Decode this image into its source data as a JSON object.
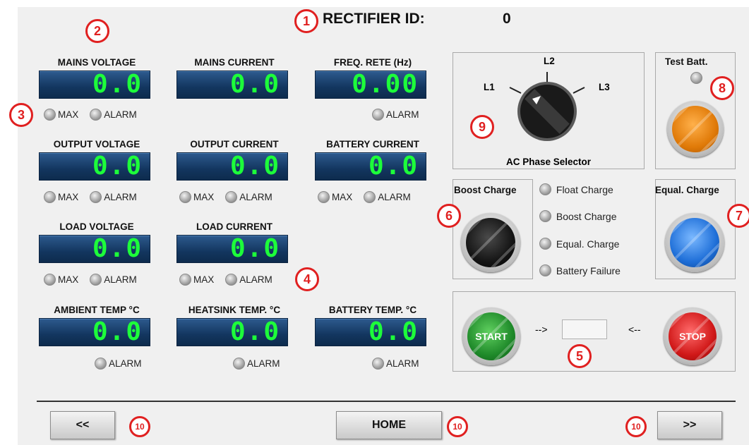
{
  "header": {
    "title": "RECTIFIER ID:",
    "id_value": "0"
  },
  "meters": {
    "mains_voltage": {
      "label": "MAINS VOLTAGE",
      "value": "0.0"
    },
    "mains_current": {
      "label": "MAINS CURRENT",
      "value": "0.0"
    },
    "freq": {
      "label": "FREQ. RETE (Hz)",
      "value": "0.00"
    },
    "output_voltage": {
      "label": "OUTPUT VOLTAGE",
      "value": "0.0"
    },
    "output_current": {
      "label": "OUTPUT CURRENT",
      "value": "0.0"
    },
    "battery_current": {
      "label": "BATTERY CURRENT",
      "value": "0.0"
    },
    "load_voltage": {
      "label": "LOAD VOLTAGE",
      "value": "0.0"
    },
    "load_current": {
      "label": "LOAD CURRENT",
      "value": "0.0"
    },
    "ambient_temp": {
      "label": "AMBIENT TEMP °C",
      "value": "0.0"
    },
    "heatsink_temp": {
      "label": "HEATSINK TEMP. °C",
      "value": "0.0"
    },
    "battery_temp": {
      "label": "BATTERY TEMP. °C",
      "value": "0.0"
    }
  },
  "leds": {
    "max": "MAX",
    "alarm": "ALARM"
  },
  "selector": {
    "title": "AC Phase Selector",
    "l1": "L1",
    "l2": "L2",
    "l3": "L3"
  },
  "test_batt": {
    "title": "Test Batt."
  },
  "boost": {
    "title": "Boost Charge"
  },
  "equal": {
    "title": "Equal. Charge"
  },
  "status": {
    "float": "Float Charge",
    "boost": "Boost Charge",
    "equal": "Equal. Charge",
    "battery_failure": "Battery Failure"
  },
  "control": {
    "start": "START",
    "stop": "STOP",
    "left_arrow": "-->",
    "right_arrow": "<--"
  },
  "nav": {
    "prev": "<<",
    "home": "HOME",
    "next": ">>"
  },
  "callouts": [
    "1",
    "2",
    "3",
    "4",
    "5",
    "6",
    "7",
    "8",
    "9",
    "10",
    "10",
    "10"
  ],
  "colors": {
    "digits": "#1dff3a",
    "meter_bg": "#13365f",
    "callout": "#e02020",
    "start": "#1f8a2a",
    "stop": "#d01818",
    "test": "#f08a10",
    "equal": "#2a7ae0"
  }
}
